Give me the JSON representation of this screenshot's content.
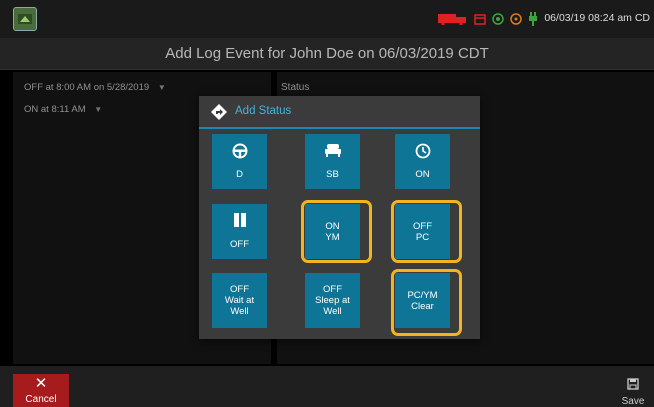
{
  "status_bar": {
    "datetime": "06/03/19 08:24 am CD",
    "icons": [
      "app-logo-icon",
      "truck-icon",
      "calendar-icon",
      "gps-icon",
      "wifi-icon",
      "power-icon"
    ],
    "colors": {
      "red_icon": "#e32020",
      "green_icon": "#3da33d",
      "orange_icon": "#e07b1a"
    }
  },
  "header": {
    "title": "Add Log Event for John Doe on 06/03/2019 CDT"
  },
  "left_panel": {
    "items": [
      {
        "label": "OFF at 8:00 AM on 5/28/2019",
        "icon": "chevron-down-icon"
      },
      {
        "label": "ON at 8:11 AM",
        "icon": "chevron-down-icon"
      }
    ]
  },
  "right_panel": {
    "label": "Status"
  },
  "dialog": {
    "title": "Add Status",
    "title_icon": "directions-icon",
    "accent": "#1e88b3",
    "tile_color": "#0f7597",
    "highlight_color": "#f3b51f",
    "tiles": [
      {
        "icon": "steering-wheel-icon",
        "lines": [
          "D"
        ]
      },
      {
        "icon": "bed-icon",
        "lines": [
          "SB"
        ]
      },
      {
        "icon": "clock-icon",
        "lines": [
          "ON"
        ]
      },
      {
        "icon": "pause-icon",
        "lines": [
          "OFF"
        ]
      },
      {
        "lines": [
          "ON",
          "YM"
        ],
        "highlighted": true
      },
      {
        "lines": [
          "OFF",
          "PC"
        ],
        "highlighted": true
      },
      {
        "lines": [
          "OFF",
          "Wait at",
          "Well"
        ]
      },
      {
        "lines": [
          "OFF",
          "Sleep at",
          "Well"
        ]
      },
      {
        "lines": [
          "PC/YM",
          "Clear"
        ],
        "highlighted": true
      }
    ]
  },
  "footer": {
    "cancel_label": "Cancel",
    "cancel_icon": "close-icon",
    "save_label": "Save",
    "save_icon": "save-icon",
    "cancel_color": "#a61b1b"
  }
}
